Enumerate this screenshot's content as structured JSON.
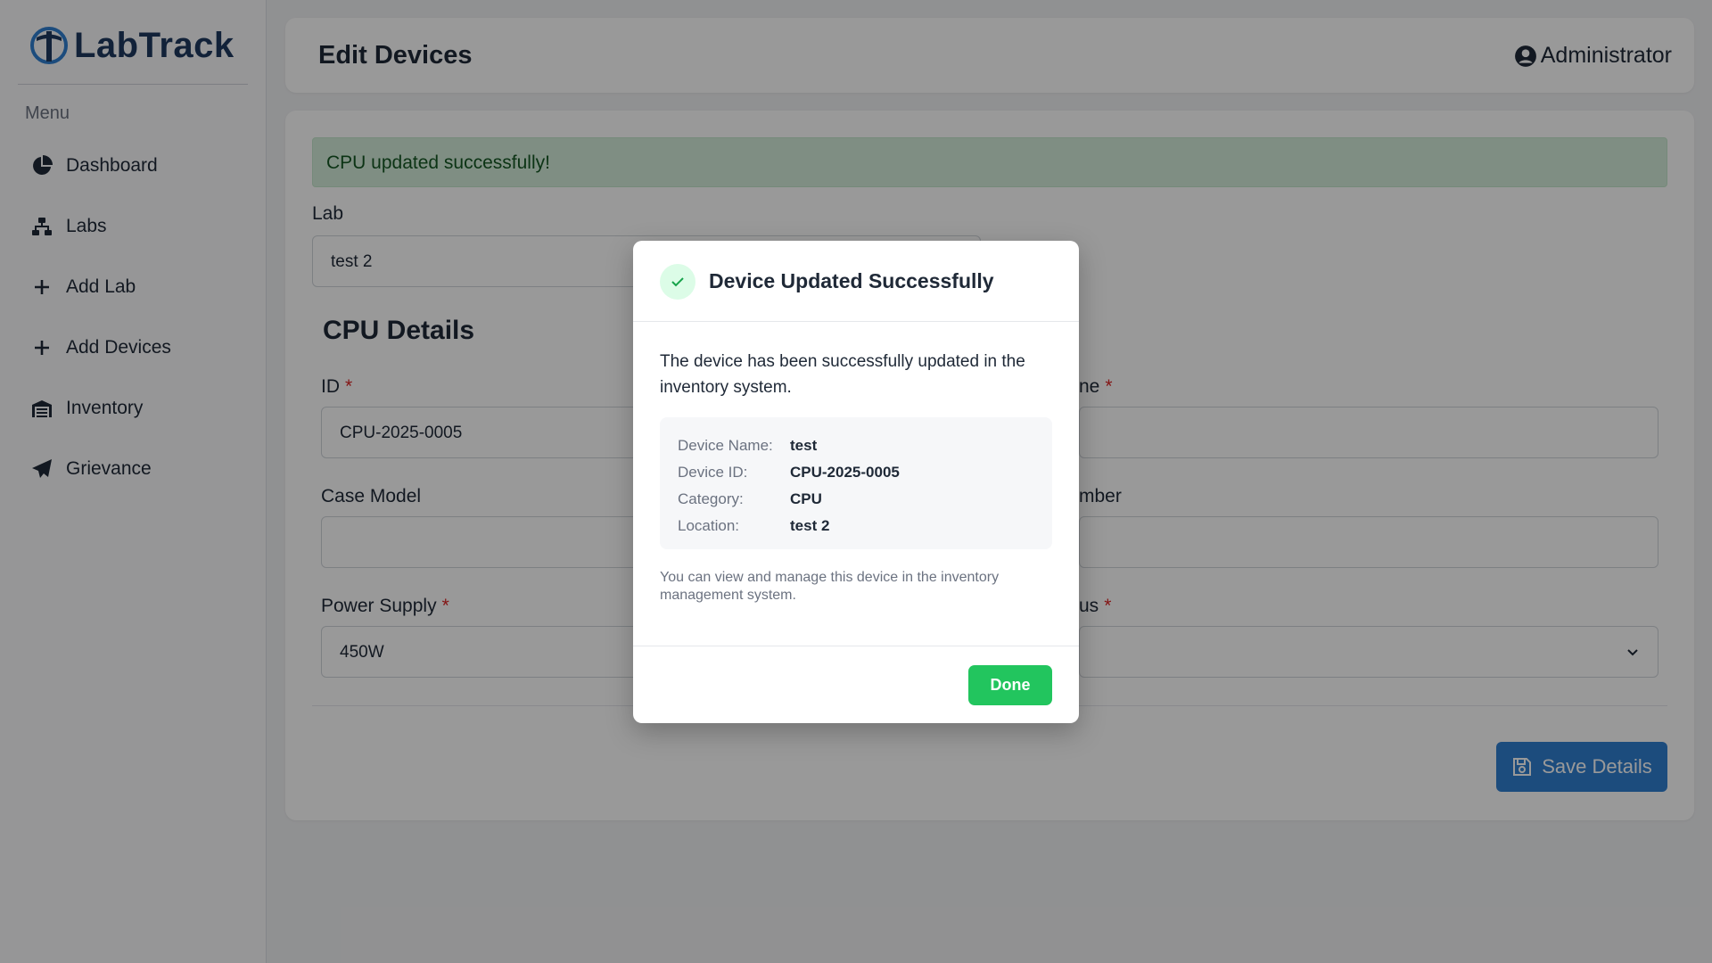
{
  "app": {
    "name": "LabTrack"
  },
  "sidebar": {
    "menu_title": "Menu",
    "items": [
      {
        "label": "Dashboard",
        "icon": "pie-chart-icon"
      },
      {
        "label": "Labs",
        "icon": "network-icon"
      },
      {
        "label": "Add Lab",
        "icon": "plus-icon"
      },
      {
        "label": "Add Devices",
        "icon": "plus-icon"
      },
      {
        "label": "Inventory",
        "icon": "warehouse-icon"
      },
      {
        "label": "Grievance",
        "icon": "paper-plane-icon"
      }
    ]
  },
  "header": {
    "title": "Edit Devices",
    "user": "Administrator"
  },
  "main": {
    "alert": "CPU updated successfully!",
    "lab_label": "Lab",
    "lab_value": "test 2",
    "section_title": "CPU Details",
    "fields": {
      "id_label": "ID",
      "id_value": "CPU-2025-0005",
      "name_label_partial": "ne",
      "case_label": "Case Model",
      "case_value": "",
      "number_label_partial": "mber",
      "psu_label": "Power Supply",
      "psu_value": "450W",
      "status_label_partial": "us",
      "required_mark": "*"
    },
    "save_label": "Save Details"
  },
  "modal": {
    "title": "Device Updated Successfully",
    "message": "The device has been successfully updated in the inventory system.",
    "details": {
      "name_key": "Device Name:",
      "name_val": "test",
      "id_key": "Device ID:",
      "id_val": "CPU-2025-0005",
      "cat_key": "Category:",
      "cat_val": "CPU",
      "loc_key": "Location:",
      "loc_val": "test 2"
    },
    "note": "You can view and manage this device in the inventory management system.",
    "done_label": "Done"
  },
  "colors": {
    "accent": "#2f7fd1",
    "success": "#22c55e",
    "brand": "#1e3a5f"
  }
}
